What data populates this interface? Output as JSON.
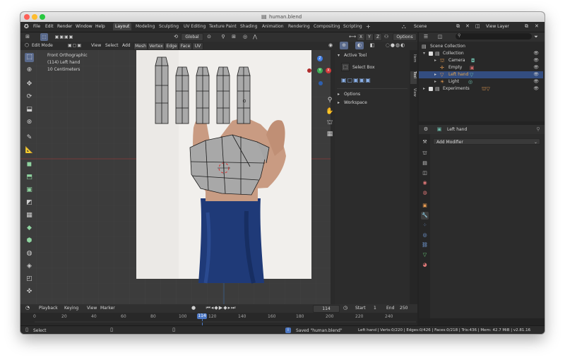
{
  "window": {
    "title": "human.blend"
  },
  "app_menu": [
    "File",
    "Edit",
    "Render",
    "Window",
    "Help"
  ],
  "workspace_tabs": [
    "Layout",
    "Modeling",
    "Sculpting",
    "UV Editing",
    "Texture Paint",
    "Shading",
    "Animation",
    "Rendering",
    "Compositing",
    "Scripting"
  ],
  "scene": "Scene",
  "view_layer": "View Layer",
  "viewport_header": {
    "mode": "Edit Mode",
    "menus": [
      "View",
      "Select",
      "Add",
      "Mesh",
      "Vertex",
      "Edge",
      "Face",
      "UV"
    ],
    "orientation": "Global",
    "options": "Options",
    "xyz": [
      "X",
      "Y",
      "Z"
    ]
  },
  "overlay_info": {
    "view": "Front Orthographic",
    "object": "(114) Left hand",
    "scale": "10 Centimeters"
  },
  "sidebar": {
    "tabs": [
      "Item",
      "Tool",
      "View"
    ],
    "active_tool_title": "Active Tool",
    "select_box": "Select Box",
    "options": "Options",
    "workspace": "Workspace"
  },
  "gizmo": {
    "z": "Z",
    "x": "X",
    "y": "Y"
  },
  "outliner": {
    "scene_collection": "Scene Collection",
    "items": [
      {
        "label": "Collection",
        "level": 1
      },
      {
        "label": "Camera",
        "level": 2
      },
      {
        "label": "Empty",
        "level": 2
      },
      {
        "label": "Left hand",
        "level": 2,
        "selected": true
      },
      {
        "label": "Light",
        "level": 2
      },
      {
        "label": "Experiments",
        "level": 1
      }
    ]
  },
  "properties": {
    "object_name": "Left hand",
    "add_modifier": "Add Modifier"
  },
  "timeline": {
    "menus": [
      "Playback",
      "Keying",
      "View",
      "Marker"
    ],
    "current_frame": "114",
    "start_label": "Start",
    "start": "1",
    "end_label": "End",
    "end": "250",
    "ticks": [
      "0",
      "20",
      "40",
      "60",
      "80",
      "100",
      "120",
      "140",
      "160",
      "180",
      "200",
      "220",
      "240"
    ],
    "playhead": "114"
  },
  "statusbar": {
    "select": "Select",
    "saved": "Saved \"human.blend\"",
    "stats": "Left hand | Verts:0/220 | Edges:0/426 | Faces:0/218 | Tris:436 | Mem: 42.7 MiB | v2.81.16"
  },
  "colors": {
    "accent": "#5680c2",
    "selected_row": "#334d80",
    "axis_red": "#d33a3a",
    "axis_green": "#3fae55",
    "axis_blue": "#3f7be0"
  }
}
